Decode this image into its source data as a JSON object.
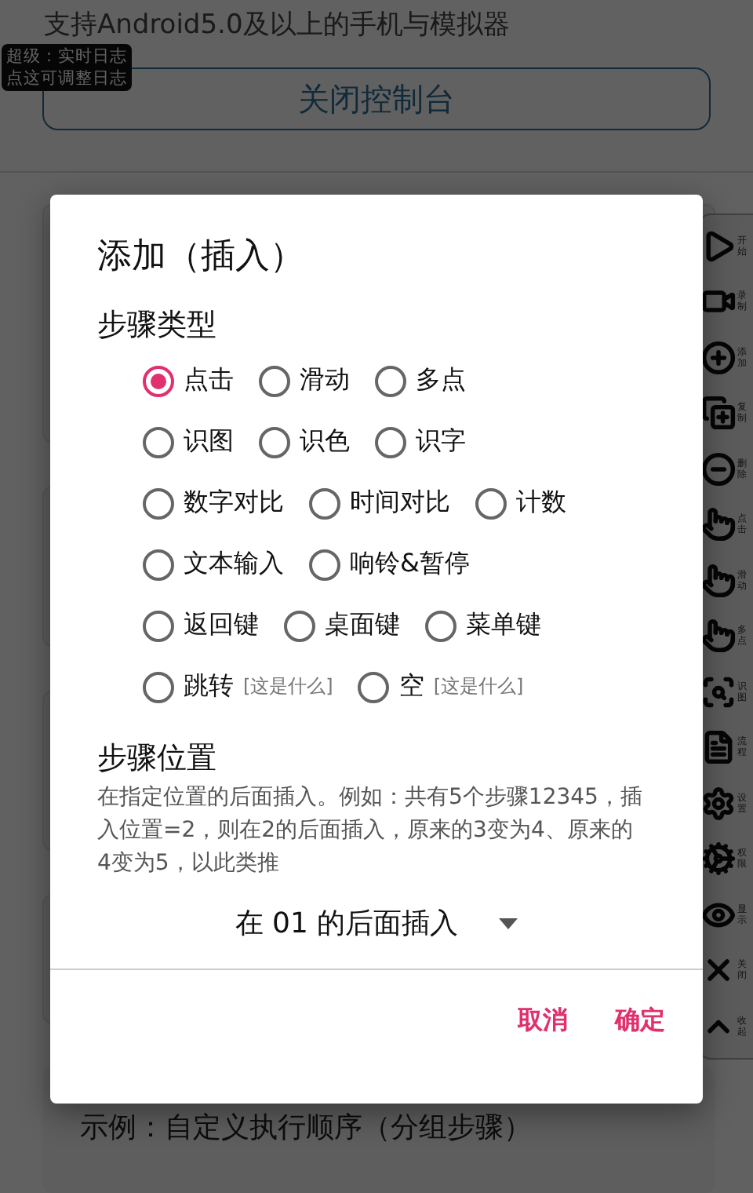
{
  "page": {
    "support_note": "支持Android5.0及以上的手机与模拟器",
    "log_tooltip": [
      "超级：实时日志",
      "点这可调整日志"
    ],
    "console_button": "关闭控制台",
    "example_title": "示例：自定义执行顺序（分组步骤）"
  },
  "toolbar": [
    {
      "kind": "play",
      "label": "开始"
    },
    {
      "kind": "video",
      "label": "录制"
    },
    {
      "kind": "plus",
      "label": "添加"
    },
    {
      "kind": "copy",
      "label": "复制"
    },
    {
      "kind": "minus",
      "label": "删除"
    },
    {
      "kind": "hand",
      "label": "点击"
    },
    {
      "kind": "hand",
      "label": "滑动"
    },
    {
      "kind": "hand",
      "label": "多点"
    },
    {
      "kind": "scan",
      "label": "识图"
    },
    {
      "kind": "doc",
      "label": "流程"
    },
    {
      "kind": "settings",
      "label": "设置"
    },
    {
      "kind": "gear",
      "label": "权限"
    },
    {
      "kind": "eye",
      "label": "显示"
    },
    {
      "kind": "close",
      "label": "关闭"
    },
    {
      "kind": "collapse",
      "label": "收起"
    }
  ],
  "dialog": {
    "title": "添加（插入）",
    "type_heading": "步骤类型",
    "options": [
      [
        {
          "label": "点击",
          "selected": true
        },
        {
          "label": "滑动",
          "selected": false
        },
        {
          "label": "多点",
          "selected": false
        }
      ],
      [
        {
          "label": "识图",
          "selected": false
        },
        {
          "label": "识色",
          "selected": false
        },
        {
          "label": "识字",
          "selected": false
        }
      ],
      [
        {
          "label": "数字对比",
          "selected": false
        },
        {
          "label": "时间对比",
          "selected": false
        },
        {
          "label": "计数",
          "selected": false
        }
      ],
      [
        {
          "label": "文本输入",
          "selected": false
        },
        {
          "label": "响铃&暂停",
          "selected": false
        }
      ],
      [
        {
          "label": "返回键",
          "selected": false
        },
        {
          "label": "桌面键",
          "selected": false
        },
        {
          "label": "菜单键",
          "selected": false
        }
      ],
      [
        {
          "label": "跳转",
          "selected": false,
          "hint": "[这是什么]"
        },
        {
          "label": "空",
          "selected": false,
          "hint": "[这是什么]"
        }
      ]
    ],
    "position_heading": "步骤位置",
    "position_note": "在指定位置的后面插入。例如：共有5个步骤12345，插入位置=2，则在2的后面插入，原来的3变为4、原来的4变为5，以此类推",
    "position_select": "在 01 的后面插入",
    "buttons": [
      "取消",
      "确定"
    ]
  }
}
